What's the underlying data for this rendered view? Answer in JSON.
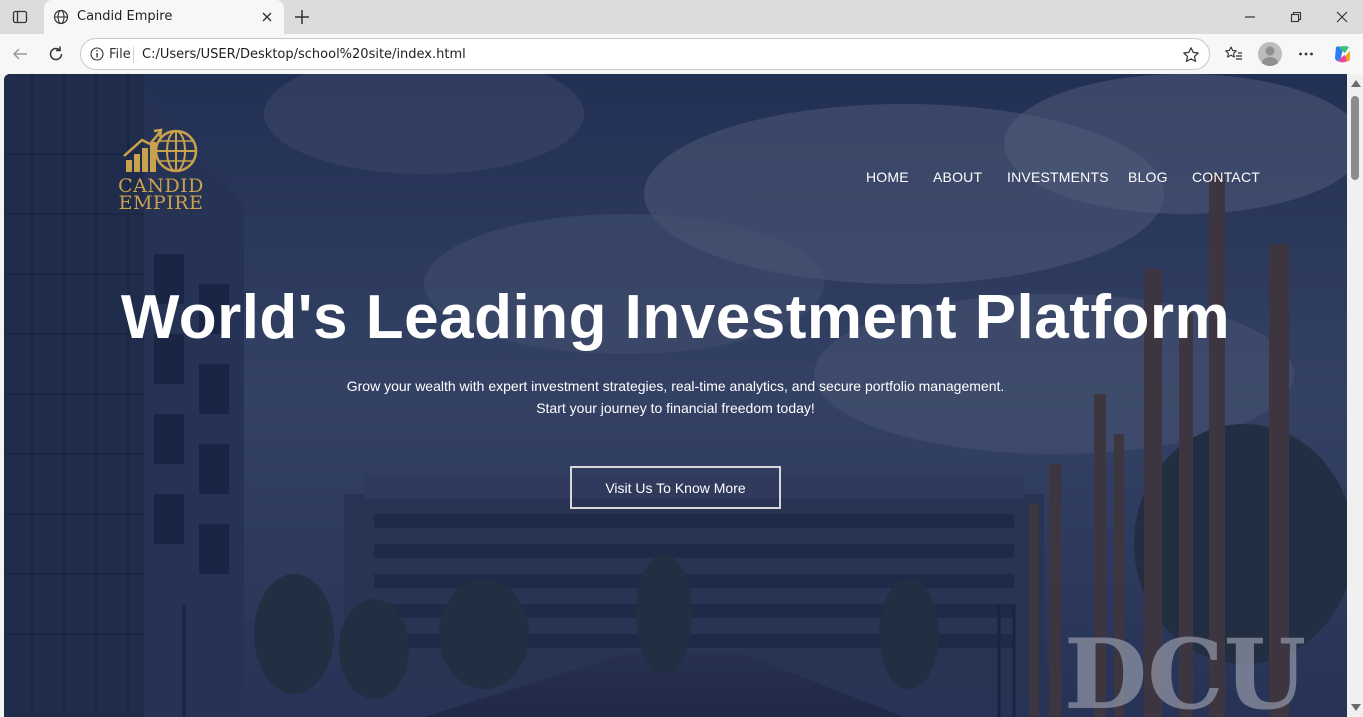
{
  "browser": {
    "tab_title": "Candid Empire",
    "address_scheme": "File",
    "address_url": "C:/Users/USER/Desktop/school%20site/index.html"
  },
  "site": {
    "logo_line1": "CANDID",
    "logo_line2": "EMPIRE",
    "nav": [
      {
        "label": "HOME"
      },
      {
        "label": "ABOUT"
      },
      {
        "label": "INVESTMENTS"
      },
      {
        "label": "BLOG"
      },
      {
        "label": "CONTACT"
      }
    ],
    "hero": {
      "title": "World's Leading Investment Platform",
      "subtitle_line1": "Grow your wealth with expert investment strategies, real-time analytics, and secure portfolio management.",
      "subtitle_line2": "Start your journey to financial freedom today!",
      "cta_label": "Visit Us To Know More"
    },
    "background_sign": "DCU"
  },
  "colors": {
    "gold": "#c9a24e",
    "overlay": "#182448",
    "text": "#ffffff"
  }
}
